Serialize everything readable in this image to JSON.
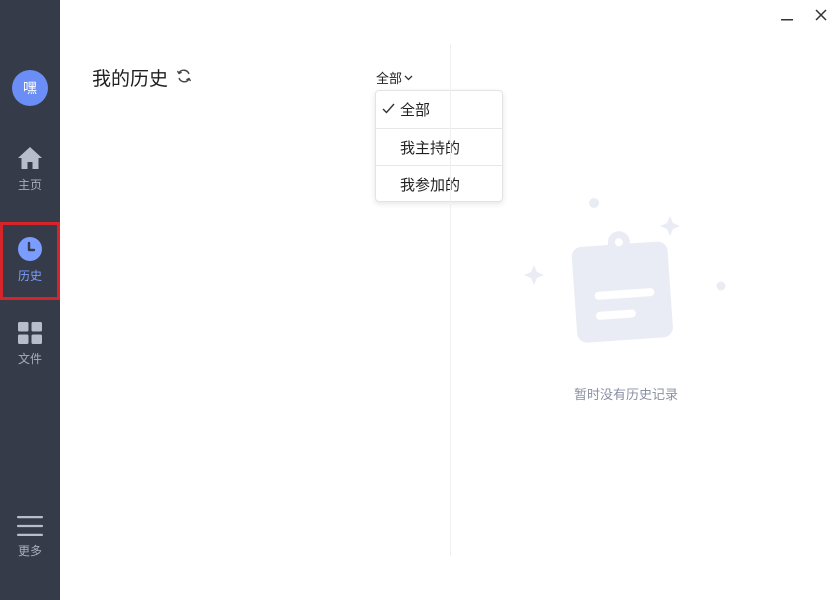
{
  "sidebar": {
    "avatar_text": "嘿",
    "items": [
      {
        "label": "主页",
        "icon": "home-icon"
      },
      {
        "label": "历史",
        "icon": "clock-icon",
        "active": true
      },
      {
        "label": "文件",
        "icon": "grid-icon"
      },
      {
        "label": "更多",
        "icon": "menu-icon"
      }
    ]
  },
  "header": {
    "title": "我的历史",
    "filter_label": "全部"
  },
  "dropdown": {
    "options": [
      {
        "label": "全部",
        "selected": true
      },
      {
        "label": "我主持的",
        "selected": false
      },
      {
        "label": "我参加的",
        "selected": false
      }
    ]
  },
  "empty_state": {
    "text": "暂时没有历史记录"
  },
  "colors": {
    "sidebar_bg": "#363b49",
    "accent": "#6a8ef5",
    "highlight_border": "#d6242b",
    "illustration": "#e9ecf4"
  }
}
